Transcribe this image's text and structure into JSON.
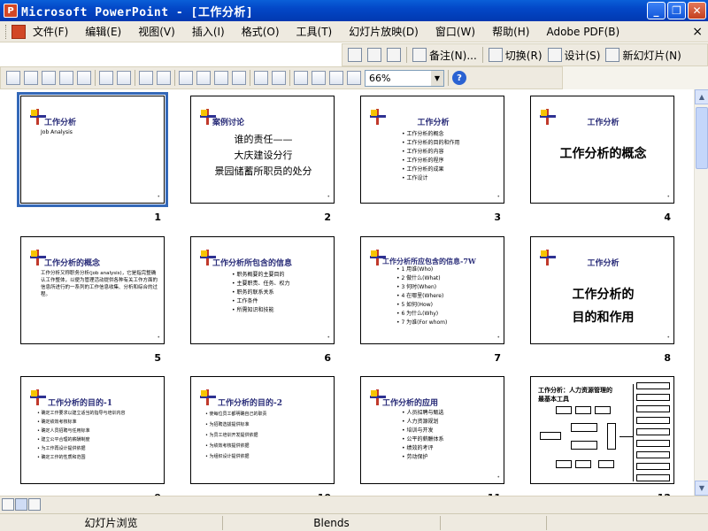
{
  "window": {
    "app_icon_letter": "P",
    "title": "Microsoft PowerPoint - [工作分析]"
  },
  "menu": {
    "items": [
      "文件(F)",
      "编辑(E)",
      "视图(V)",
      "插入(I)",
      "格式(O)",
      "工具(T)",
      "幻灯片放映(D)",
      "窗口(W)",
      "帮助(H)",
      "Adobe PDF(B)"
    ]
  },
  "toolbar1": {
    "notes": "备注(N)...",
    "switch": "切换(R)",
    "design": "设计(S)",
    "new_slide": "新幻灯片(N)"
  },
  "toolbar2": {
    "zoom": "66%"
  },
  "slides": [
    {
      "num": "1",
      "title": "工作分析",
      "subtitle": "Job Analysis"
    },
    {
      "num": "2",
      "title": "案例讨论",
      "lines": [
        "谁的责任——",
        "大庆建设分行",
        "景园储蓄所职员的处分"
      ]
    },
    {
      "num": "3",
      "title": "工作分析",
      "bullets": [
        "工作分析的概念",
        "工作分析的目的和作用",
        "工作分析的内容",
        "工作分析的程序",
        "工作分析的成果",
        "工作设计"
      ]
    },
    {
      "num": "4",
      "title": "工作分析",
      "big": "工作分析的概念"
    },
    {
      "num": "5",
      "title": "工作分析的概念",
      "para": "工作分析又称职务分析(job analysis)，它是指完整确认工作整体，以便为管理活动提供各种有关工作方面的信息所进行的一系列的工作信息收集、分析和综合的过程。"
    },
    {
      "num": "6",
      "title": "工作分析所包含的信息",
      "bullets": [
        "职务概要的主要目的",
        "主要职责、任务、权力",
        "职务的联系关系",
        "工作条件",
        "所需知识和技能"
      ]
    },
    {
      "num": "7",
      "title": "工作分析所应包含的信息-7W",
      "bullets": [
        "1  用谁(Who)",
        "2  做什么(What)",
        "3  何时(When)",
        "4  在哪里(Where)",
        "5  如何(How)",
        "6  为什么(Why)",
        "7  为谁(For whom)"
      ]
    },
    {
      "num": "8",
      "title": "工作分析",
      "big_lines": [
        "工作分析的",
        "目的和作用"
      ]
    },
    {
      "num": "9",
      "title": "工作分析的目的-1",
      "bullets": [
        "确定工作要求以建立适当的指导与培训内容",
        "确定绩效考核标准",
        "确定人员招聘与任用标准",
        "建立公平合理的薪酬制度",
        "为工作再设计提供依据",
        "确定工作的性质和范围"
      ]
    },
    {
      "num": "10",
      "title": "工作分析的目的-2",
      "bullets": [
        "使每位员工都明确自己的职责",
        "为招聘选拔提供标准",
        "为员工培训开发提供依据",
        "为绩效考核提供依据",
        "为组织设计提供依据"
      ]
    },
    {
      "num": "11",
      "title": "工作分析的应用",
      "bullets": [
        "人员招聘与甄选",
        "人力资源规划",
        "培训与开发",
        "公平的薪酬体系",
        "绩效的考评",
        "劳动保护"
      ]
    },
    {
      "num": "12",
      "title": "工作分析：人力资源管理的最基本工具"
    }
  ],
  "status": {
    "view_name": "幻灯片浏览",
    "design_name": "Blends"
  },
  "colors": {
    "titlebar": "#0347c7",
    "menubar": "#eeeae0",
    "slide_title": "#2b2e7a",
    "selection": "#3468b8"
  }
}
